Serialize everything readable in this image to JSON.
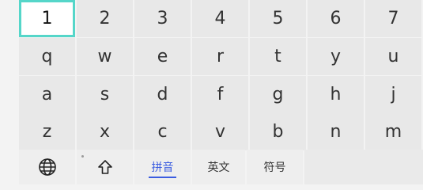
{
  "keyboard": {
    "rows": [
      [
        "1",
        "2",
        "3",
        "4",
        "5",
        "6",
        "7"
      ],
      [
        "q",
        "w",
        "e",
        "r",
        "t",
        "y",
        "u"
      ],
      [
        "a",
        "s",
        "d",
        "f",
        "g",
        "h",
        "j"
      ],
      [
        "z",
        "x",
        "c",
        "v",
        "b",
        "n",
        "m"
      ]
    ],
    "focused_key": "1",
    "bottom_row": {
      "language_icon": "globe-icon",
      "shift_icon": "shift-arrow-icon",
      "tabs": [
        "拼音",
        "英文",
        "符号"
      ],
      "active_tab": "拼音"
    },
    "colors": {
      "focus_border": "#55d6c9",
      "active_tab": "#3b5ce0",
      "key_bg": "#e8e8e8"
    }
  }
}
